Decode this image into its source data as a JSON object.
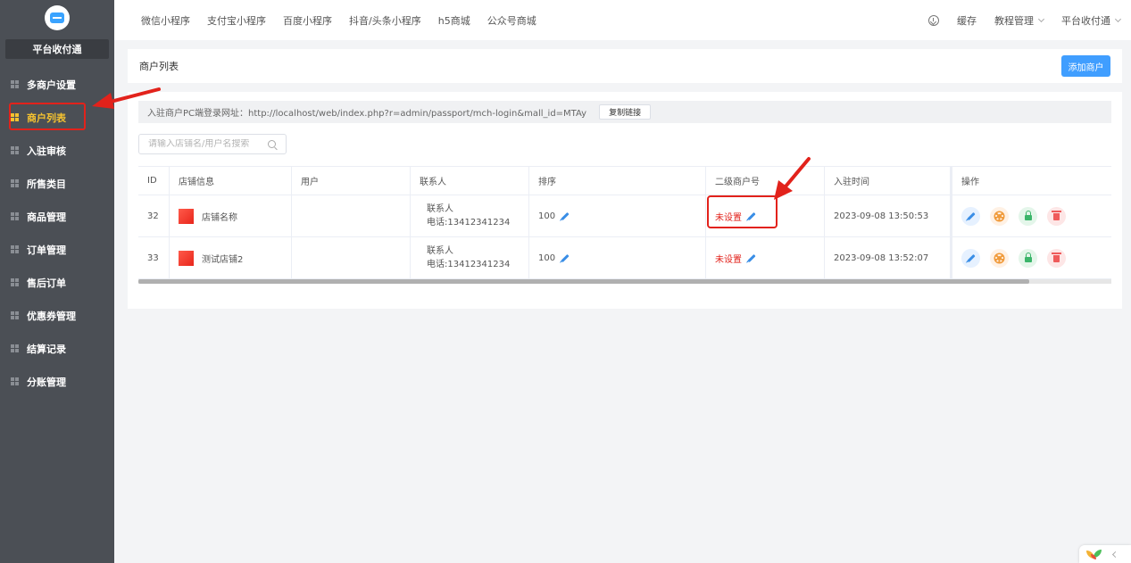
{
  "sidebar": {
    "platform_title": "平台收付通",
    "items": [
      {
        "label": "多商户设置",
        "active": false
      },
      {
        "label": "商户列表",
        "active": true
      },
      {
        "label": "入驻审核",
        "active": false
      },
      {
        "label": "所售类目",
        "active": false
      },
      {
        "label": "商品管理",
        "active": false
      },
      {
        "label": "订单管理",
        "active": false
      },
      {
        "label": "售后订单",
        "active": false
      },
      {
        "label": "优惠券管理",
        "active": false
      },
      {
        "label": "结算记录",
        "active": false
      },
      {
        "label": "分账管理",
        "active": false
      }
    ]
  },
  "topbar": {
    "tabs": [
      "微信小程序",
      "支付宝小程序",
      "百度小程序",
      "抖音/头条小程序",
      "h5商城",
      "公众号商城"
    ],
    "cache_label": "缓存",
    "tutorial_label": "教程管理",
    "user_label": "平台收付通"
  },
  "header": {
    "title": "商户列表",
    "add_button": "添加商户"
  },
  "login_url": {
    "text": "入驻商户PC端登录网址：http://localhost/web/index.php?r=admin/passport/mch-login&mall_id=MTAy",
    "copy_button": "复制链接"
  },
  "search": {
    "placeholder": "请输入店铺名/用户名搜索"
  },
  "table": {
    "columns": [
      "ID",
      "店铺信息",
      "用户",
      "联系人",
      "排序",
      "二级商户号",
      "入驻时间",
      "操作"
    ],
    "rows": [
      {
        "id": "32",
        "store": "店铺名称",
        "user": "",
        "contact_name": "联系人",
        "contact_phone": "电话:13412341234",
        "sort": "100",
        "sub_merchant": "未设置",
        "time": "2023-09-08 13:50:53"
      },
      {
        "id": "33",
        "store": "测试店铺2",
        "user": "",
        "contact_name": "联系人",
        "contact_phone": "电话:13412341234",
        "sort": "100",
        "sub_merchant": "未设置",
        "time": "2023-09-08 13:52:07"
      }
    ]
  },
  "colors": {
    "sidebar_bg": "#4b4f55",
    "active_text": "#f5c230",
    "annotation_red": "#e2221b",
    "primary_blue": "#409eff"
  }
}
